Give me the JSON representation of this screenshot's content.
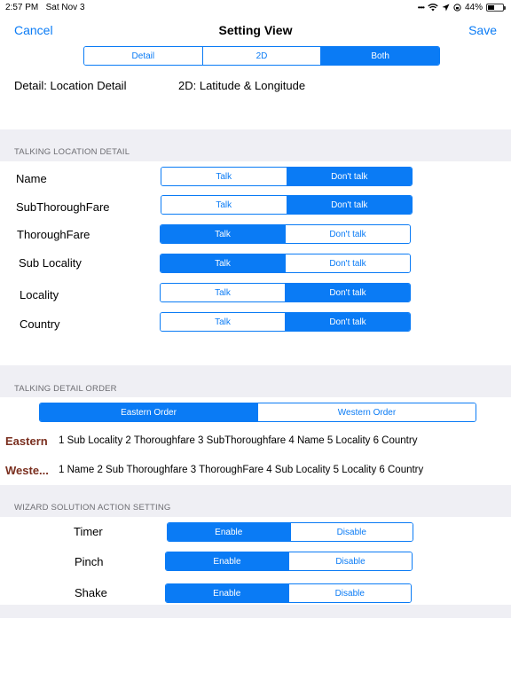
{
  "status_bar": {
    "time": "2:57 PM",
    "date": "Sat Nov 3",
    "battery": "44%",
    "battery_level": 0.44
  },
  "nav": {
    "cancel": "Cancel",
    "title": "Setting View",
    "save": "Save"
  },
  "view_mode": {
    "options": [
      "Detail",
      "2D",
      "Both"
    ],
    "selected": "Both"
  },
  "info": {
    "detail": "Detail: Location Detail",
    "twod": "2D: Latitude & Longitude"
  },
  "talking_location_detail": {
    "header": "TALKING LOCATION DETAIL",
    "options": [
      "Talk",
      "Don't talk"
    ],
    "rows": [
      {
        "label": "Name",
        "selected": "Don't talk"
      },
      {
        "label": "SubThoroughFare",
        "selected": "Don't talk"
      },
      {
        "label": "ThoroughFare",
        "selected": "Talk"
      },
      {
        "label": "Sub Locality",
        "selected": "Talk"
      },
      {
        "label": "Locality",
        "selected": "Don't talk"
      },
      {
        "label": "Country",
        "selected": "Don't talk"
      }
    ]
  },
  "talking_detail_order": {
    "header": "TALKING DETAIL ORDER",
    "options": [
      "Eastern Order",
      "Western Order"
    ],
    "selected": "Eastern Order",
    "eastern": {
      "label": "Eastern",
      "text": "1 Sub Locality 2 Thoroughfare 3 SubThoroughfare 4 Name 5 Locality 6 Country"
    },
    "western": {
      "label": "Weste...",
      "text": "1 Name 2 Sub Thoroughfare 3 ThoroughFare 4 Sub Locality 5 Locality 6 Country"
    }
  },
  "wizard_solution": {
    "header": "WIZARD SOLUTION ACTION SETTING",
    "options": [
      "Enable",
      "Disable"
    ],
    "rows": [
      {
        "label": "Timer",
        "selected": "Enable"
      },
      {
        "label": "Pinch",
        "selected": "Enable"
      },
      {
        "label": "Shake",
        "selected": "Enable"
      }
    ]
  },
  "colors": {
    "accent": "#0a7bf5",
    "section_bg": "#efeff4",
    "order_label": "#7a2f1f"
  },
  "icons": [
    "signal-dots-icon",
    "wifi-icon",
    "location-arrow-icon",
    "lock-rotation-icon",
    "battery-icon"
  ]
}
